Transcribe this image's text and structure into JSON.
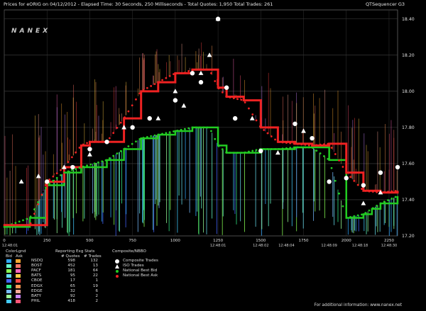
{
  "header": {
    "left_text": "Prices for  eORIG  on  04/12/2012  -  Elapsed Time: 30 Seconds, 250 Milliseconds  -  Total Quotes: 1,950  Total Trades: 261",
    "right_text": "QTSequencer G3"
  },
  "logo_text": "NANEX",
  "chart_data": {
    "type": "line",
    "title": "Prices for eORIG on 04/12/2012",
    "x_ticks": [
      "0",
      "250",
      "500",
      "750",
      "1000",
      "1250",
      "1500",
      "1750",
      "2000",
      "2250"
    ],
    "x_sub_labels": [
      "12:48:01",
      "12:48:01",
      "12:48:02",
      "12:48:04",
      "12:48:09",
      "12:48:18",
      "12:48:30"
    ],
    "y_ticks": [
      "17.20",
      "17.40",
      "17.60",
      "17.80",
      "18.00",
      "18.20",
      "18.40"
    ],
    "ylim": [
      17.2,
      18.45
    ],
    "xlim": [
      0,
      2300
    ],
    "grid": true,
    "series": [
      {
        "name": "National Best Bid",
        "color": "#22cc22",
        "x": [
          0,
          150,
          250,
          350,
          450,
          600,
          700,
          800,
          900,
          1000,
          1100,
          1200,
          1250,
          1300,
          1400,
          1500,
          1600,
          1700,
          1800,
          1900,
          2000,
          2100,
          2150,
          2200,
          2300
        ],
        "values": [
          17.25,
          17.3,
          17.48,
          17.55,
          17.58,
          17.62,
          17.68,
          17.74,
          17.76,
          17.78,
          17.8,
          17.8,
          17.7,
          17.66,
          17.66,
          17.68,
          17.68,
          17.69,
          17.69,
          17.62,
          17.3,
          17.32,
          17.35,
          17.38,
          17.42
        ]
      },
      {
        "name": "National Best Ask",
        "color": "#ee2222",
        "x": [
          0,
          150,
          250,
          350,
          450,
          500,
          600,
          700,
          800,
          900,
          1000,
          1050,
          1100,
          1200,
          1250,
          1300,
          1400,
          1500,
          1600,
          1700,
          1800,
          1900,
          2000,
          2100,
          2200,
          2300
        ],
        "values": [
          17.26,
          17.26,
          17.5,
          17.58,
          17.7,
          17.72,
          17.72,
          17.85,
          18.0,
          18.05,
          18.1,
          18.1,
          18.12,
          18.12,
          18.02,
          17.97,
          17.95,
          17.8,
          17.72,
          17.71,
          17.7,
          17.71,
          17.55,
          17.45,
          17.44,
          17.45
        ]
      },
      {
        "name": "Composite Trades",
        "color": "#ffffff",
        "x": [
          250,
          400,
          500,
          600,
          750,
          850,
          1000,
          1100,
          1150,
          1250,
          1300,
          1350,
          1500,
          1700,
          1800,
          1900,
          2000,
          2100,
          2200,
          2300
        ],
        "values": [
          17.5,
          17.58,
          17.68,
          17.72,
          17.8,
          17.85,
          17.95,
          18.1,
          18.05,
          18.4,
          18.02,
          17.85,
          17.67,
          17.82,
          17.74,
          17.5,
          17.52,
          17.48,
          17.55,
          17.58
        ]
      },
      {
        "name": "ISO Trades",
        "color": "#ffffff",
        "x": [
          100,
          200,
          350,
          500,
          700,
          900,
          1000,
          1050,
          1150,
          1200,
          1250,
          1450,
          1600,
          1750,
          2100,
          2200
        ],
        "values": [
          17.5,
          17.53,
          17.58,
          17.65,
          17.8,
          17.85,
          18.0,
          17.92,
          18.1,
          18.2,
          18.4,
          17.85,
          17.66,
          17.78,
          17.38,
          17.44
        ]
      }
    ]
  },
  "legend": {
    "color_legend_title": "ColorLgnd",
    "bid_label": "Bid",
    "ask_label": "Ask",
    "stats_title": "Reporting Exg Stats",
    "quotes_header": "# Quotes",
    "trades_header": "# Trades",
    "exchanges": [
      {
        "code": "NSDQ",
        "quotes": "598",
        "trades": "132",
        "bid_color": "#33aaff",
        "ask_color": "#ffaa33"
      },
      {
        "code": "BOST",
        "quotes": "452",
        "trades": "13",
        "bid_color": "#66ffcc",
        "ask_color": "#ff7766"
      },
      {
        "code": "PACF",
        "quotes": "181",
        "trades": "64",
        "bid_color": "#88ff55",
        "ask_color": "#ff66bb"
      },
      {
        "code": "BATS",
        "quotes": "95",
        "trades": "22",
        "bid_color": "#66ddee",
        "ask_color": "#ffcc44"
      },
      {
        "code": "CBOE",
        "quotes": "17",
        "trades": "1",
        "bid_color": "#4466ff",
        "ask_color": "#ff4444"
      },
      {
        "code": "EDGX",
        "quotes": "65",
        "trades": "19",
        "bid_color": "#33ee88",
        "ask_color": "#ff9955"
      },
      {
        "code": "EDGE",
        "quotes": "32",
        "trades": "6",
        "bid_color": "#77bbff",
        "ask_color": "#ffaa99"
      },
      {
        "code": "BATY",
        "quotes": "92",
        "trades": "2",
        "bid_color": "#99ff99",
        "ask_color": "#cc88ff"
      },
      {
        "code": "PHIL",
        "quotes": "418",
        "trades": "2",
        "bid_color": "#44ccff",
        "ask_color": "#ff5577"
      }
    ],
    "composite_title": "Composite/NBBO",
    "composite_items": [
      {
        "label": "Composite Trades",
        "marker": "circle",
        "color": "#ffffff"
      },
      {
        "label": "ISO Trades",
        "marker": "triangle",
        "color": "#ffffff"
      },
      {
        "label": "National Best Bid",
        "marker": "dot",
        "color": "#22cc22"
      },
      {
        "label": "National Best Ask",
        "marker": "dot",
        "color": "#ee2222"
      }
    ]
  },
  "footer_text": "For additional information: www.nanex.net"
}
